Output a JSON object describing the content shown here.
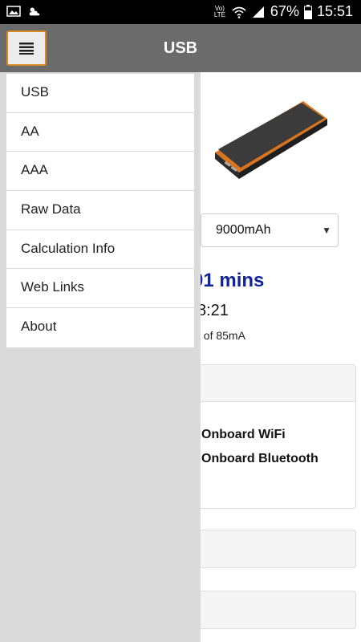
{
  "statusbar": {
    "network": "Vo) LTE",
    "battery_percent": "67%",
    "time": "15:51"
  },
  "appbar": {
    "title": "USB"
  },
  "content": {
    "capacity_selected": "9000mAh",
    "runtime_partial": "01 mins",
    "time_partial": "8:21",
    "draw_partial": "t of 85mA",
    "options": [
      "Onboard WiFi",
      "Onboard Bluetooth"
    ]
  },
  "drawer": {
    "items": [
      "USB",
      "AA",
      "AAA",
      "Raw Data",
      "Calculation Info",
      "Web Links",
      "About"
    ]
  },
  "colors": {
    "appbar": "#6b6b6b",
    "menu_button_border": "#d68a21",
    "runtime_text": "#12249a",
    "drawer_bg": "#dadada"
  }
}
